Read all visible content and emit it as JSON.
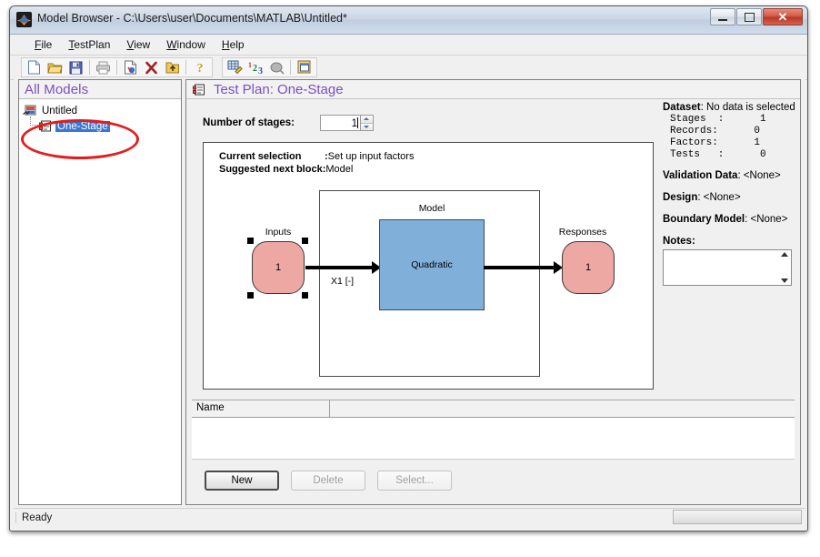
{
  "window": {
    "title": "Model Browser - C:\\Users\\user\\Documents\\MATLAB\\Untitled*",
    "icon": "matlab-icon",
    "minimize": "–",
    "maximize": "□",
    "close": "✕"
  },
  "menubar": {
    "items": [
      {
        "label": "File",
        "mnemonic": "F"
      },
      {
        "label": "TestPlan",
        "mnemonic": "T"
      },
      {
        "label": "View",
        "mnemonic": "V"
      },
      {
        "label": "Window",
        "mnemonic": "W"
      },
      {
        "label": "Help",
        "mnemonic": "H"
      }
    ]
  },
  "toolbar": {
    "group1": [
      {
        "name": "new-file-icon"
      },
      {
        "name": "open-folder-icon"
      },
      {
        "name": "save-icon"
      },
      {
        "sep": true
      },
      {
        "name": "print-icon"
      },
      {
        "sep": true
      },
      {
        "name": "edit-properties-icon"
      },
      {
        "name": "delete-x-icon"
      },
      {
        "name": "up-folder-icon"
      },
      {
        "sep": true
      },
      {
        "name": "help-question-icon"
      }
    ],
    "group2": [
      {
        "name": "data-table-icon"
      },
      {
        "name": "numbers-123-icon"
      },
      {
        "name": "boundary-model-icon"
      },
      {
        "sep": true
      },
      {
        "name": "window-layout-icon"
      }
    ]
  },
  "left_pane": {
    "header": "All Models",
    "tree": [
      {
        "label": "Untitled",
        "icon": "project-icon",
        "selected": false,
        "level": 0
      },
      {
        "label": "One-Stage",
        "icon": "testplan-icon",
        "selected": true,
        "level": 1
      }
    ]
  },
  "right_pane": {
    "header": "Test Plan: One-Stage",
    "header_icon": "testplan-icon",
    "stages": {
      "label": "Number of stages:",
      "value": "1"
    },
    "diagram": {
      "current_selection_key": "Current selection",
      "current_selection_sep": ":",
      "current_selection_value": "Set up input factors",
      "next_block_key": "Suggested next block:",
      "next_block_value": "Model",
      "inputs_label": "Inputs",
      "inputs_count": "1",
      "model_label": "Model",
      "model_type": "Quadratic",
      "responses_label": "Responses",
      "responses_count": "1",
      "edge_label": "X1 [-]"
    },
    "info": {
      "dataset_key": "Dataset",
      "dataset_value": ": No data is selected",
      "stats": "Stages  :      1\nRecords:      0\nFactors:      1\nTests   :      0",
      "validation_key": "Validation Data",
      "validation_value": ": <None>",
      "design_key": "Design",
      "design_value": ": <None>",
      "boundary_key": "Boundary Model",
      "boundary_value": ": <None>",
      "notes_label": "Notes:",
      "notes_value": ""
    },
    "list": {
      "columns": [
        "Name",
        ""
      ],
      "rows": [],
      "buttons": [
        {
          "label": "New",
          "state": "default"
        },
        {
          "label": "Delete",
          "state": "disabled"
        },
        {
          "label": "Select...",
          "state": "disabled"
        }
      ]
    }
  },
  "statusbar": {
    "text": "Ready",
    "progress": ""
  },
  "annotation": {
    "shape": "ellipse",
    "color": "#e41c1c",
    "target": "One-Stage tree node"
  }
}
